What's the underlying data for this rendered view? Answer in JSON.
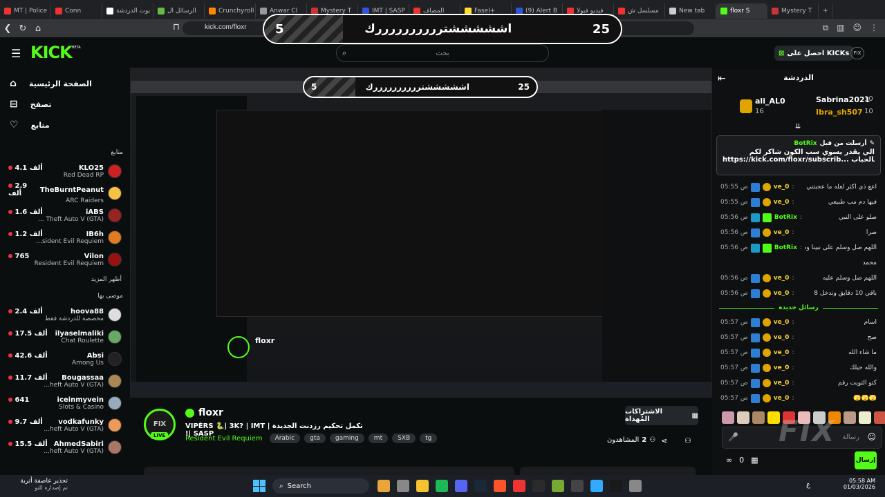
{
  "browser": {
    "tabs": [
      {
        "label": "MT | Police",
        "color": "#e33"
      },
      {
        "label": "Conn",
        "color": "#e33"
      },
      {
        "label": "بوت الدردشة",
        "color": "#fff"
      },
      {
        "label": "الرسائل ال",
        "color": "#6b4"
      },
      {
        "label": "Crunchyroll",
        "color": "#f80"
      },
      {
        "label": "Anwar Cl",
        "color": "#999"
      },
      {
        "label": "Mystery T",
        "color": "#c33"
      },
      {
        "label": "IMT | SASP",
        "color": "#35d"
      },
      {
        "label": "المضاف",
        "color": "#e33"
      },
      {
        "label": "Fasel+",
        "color": "#fd3"
      },
      {
        "label": "(9) Alert B",
        "color": "#35d"
      },
      {
        "label": "فيديو فيولا",
        "color": "#e33"
      },
      {
        "label": "مسلسل ش",
        "color": "#e33"
      },
      {
        "label": "New tab",
        "color": "#ccc"
      },
      {
        "label": "floxr S",
        "color": "#53fc18"
      },
      {
        "label": "Mystery T",
        "color": "#c33"
      }
    ],
    "url": "kick.com/floxr",
    "new_tab": "+"
  },
  "poll": {
    "left_count": "5",
    "right_count": "25",
    "text": "اشششششتررررررررررك"
  },
  "header": {
    "logo": "KICK",
    "logo_beta": "BETA",
    "search_placeholder": "بحث",
    "get_kicks": "احصل على KICKs"
  },
  "sidebar": {
    "nav": [
      {
        "label": "الصفحة الرئيسية",
        "icon": "home-icon"
      },
      {
        "label": "تصفح",
        "icon": "browse-icon"
      },
      {
        "label": "متابع",
        "icon": "heart-icon"
      }
    ],
    "following_title": "متابع",
    "following": [
      {
        "name": "KLO25",
        "viewers": "4.1 ألف",
        "game": "Red Dead RP",
        "color": "#c22"
      },
      {
        "name": "TheBurntPeanut",
        "viewers": "2.9 ألف",
        "game": "ARC Raiders",
        "color": "#f5c242"
      },
      {
        "name": "iABS",
        "viewers": "1.6 ألف",
        "game": "... Theft Auto V (GTA)",
        "color": "#922"
      },
      {
        "name": "IB6h",
        "viewers": "1.2 ألف",
        "game": "...sident Evil Requiem",
        "color": "#e07b20"
      },
      {
        "name": "Vilon",
        "viewers": "765",
        "game": "Resident Evil Requiem",
        "color": "#911"
      }
    ],
    "show_more": "أظهر المزيد",
    "recommended_title": "موصى بها",
    "recommended": [
      {
        "name": "hoova88",
        "viewers": "2.4 ألف",
        "game": "مخصصة للدردشة فقط",
        "color": "#ddd"
      },
      {
        "name": "ilyaselmaliki",
        "viewers": "17.5 ألف",
        "game": "Chat Roulette",
        "color": "#6a6"
      },
      {
        "name": "Absi",
        "viewers": "42.6 ألف",
        "game": "Among Us",
        "color": "#222"
      },
      {
        "name": "Bougassaa",
        "viewers": "11.7 ألف",
        "game": "...heft Auto V (GTA)",
        "color": "#a85"
      },
      {
        "name": "iceinmyvein",
        "viewers": "641",
        "game": "Slots & Casino",
        "color": "#9ab"
      },
      {
        "name": "vodkafunky",
        "viewers": "9.7 ألف",
        "game": "...heft Auto V (GTA)",
        "color": "#e95"
      },
      {
        "name": "AhmedSabiri",
        "viewers": "15.5 ألف",
        "game": "...heft Auto V (GTA)",
        "color": "#a76"
      }
    ]
  },
  "stream": {
    "channel": "floxr",
    "title": "تكمل تحكيم رزدنت الجديدة | VIPÈRS 🐍| 3K? | IMT | SASP!",
    "game": "Resident Evil Requiem",
    "tags": [
      "Arabic",
      "gta",
      "gaming",
      "mt",
      "SXB",
      "tg"
    ],
    "live": "LIVE",
    "subscribe": "الاشتراكات المُهداة",
    "viewers_label": "المشاهدون",
    "viewers_count": "2"
  },
  "chat": {
    "title": "الدردشة",
    "top": [
      {
        "name": "Sabrina2021",
        "count": "10"
      },
      {
        "name": "ali_AL0",
        "count": "16"
      },
      {
        "name": "Ibra_sh507",
        "count": "10"
      }
    ],
    "pinned": {
      "by": "أرسلت من قبل",
      "user": "BotRix",
      "text": "الي يقدر يسوي سب الكون شاكر لكم",
      "link": "https://kick.com/floxr/subscrib...",
      "suffix": "بالحباب"
    },
    "messages": [
      {
        "time": "05:55 ص",
        "user": "ve_0",
        "text": "اعع ذي اكثر لعله ما عجبتني"
      },
      {
        "time": "05:55 ص",
        "user": "ve_0",
        "text": "فيها دم مب طبيعي"
      },
      {
        "time": "05:56 ص",
        "user": "BotRix",
        "text": "صلو على النبي",
        "bot": true
      },
      {
        "time": "05:56 ص",
        "user": "ve_0",
        "text": "صرا"
      },
      {
        "time": "05:56 ص",
        "user": "BotRix",
        "text": "اللهم صل وسلم على نبينا وسيدنا",
        "bot": true
      },
      {
        "time": "",
        "user": "",
        "text": "محمد"
      },
      {
        "time": "05:56 ص",
        "user": "ve_0",
        "text": "اللهم صل وسلم عليه"
      },
      {
        "time": "05:56 ص",
        "user": "ve_0",
        "text": "باقي 10 دقايق وندخل 8"
      }
    ],
    "new_messages": "رسائل جديدة",
    "new": [
      {
        "time": "05:57 ص",
        "user": "ve_0",
        "text": "اسام"
      },
      {
        "time": "05:57 ص",
        "user": "ve_0",
        "text": "صح"
      },
      {
        "time": "05:57 ص",
        "user": "ve_0",
        "text": "ما شاء الله"
      },
      {
        "time": "05:57 ص",
        "user": "ve_0",
        "text": "والله حيلك"
      },
      {
        "time": "05:57 ص",
        "user": "ve_0",
        "text": "كتو التويت رقم"
      },
      {
        "time": "05:57 ص",
        "user": "ve_0",
        "text": "🫣🫣🫣"
      }
    ],
    "input_placeholder": "رسالة",
    "points": "0",
    "send": "إرسال",
    "watermark": "FIX"
  },
  "taskbar": {
    "search": "Search",
    "time": "05:58 AM",
    "date": "01/03/2026",
    "lang": "ع",
    "notice_title": "تحذير عاصفة أتربة",
    "notice_sub": "تم إصداره للتو"
  }
}
